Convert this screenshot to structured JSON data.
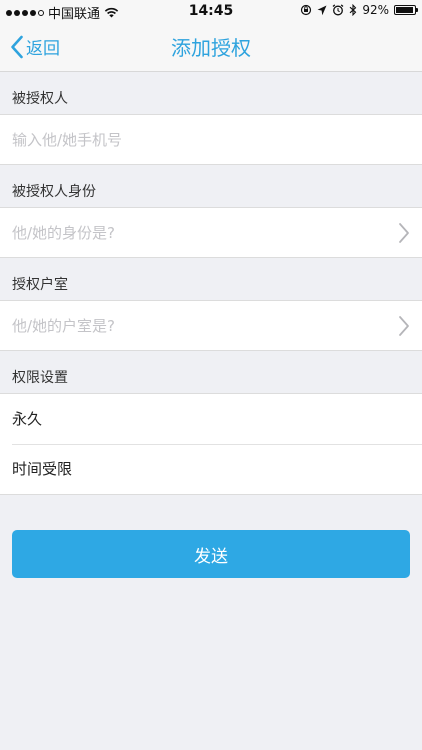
{
  "status_bar": {
    "carrier": "中国联通",
    "time": "14:45",
    "battery_text": "92%",
    "battery_level": 0.92
  },
  "nav": {
    "back_label": "返回",
    "title": "添加授权"
  },
  "form": {
    "grantee": {
      "label": "被授权人",
      "placeholder": "输入他/她手机号"
    },
    "identity": {
      "label": "被授权人身份",
      "placeholder": "他/她的身份是?"
    },
    "room": {
      "label": "授权户室",
      "placeholder": "他/她的户室是?"
    },
    "permission": {
      "label": "权限设置",
      "options": [
        "永久",
        "时间受限"
      ]
    }
  },
  "send_label": "发送",
  "colors": {
    "accent": "#2ea3de",
    "button": "#2ea8e4",
    "background": "#eff0f4"
  }
}
